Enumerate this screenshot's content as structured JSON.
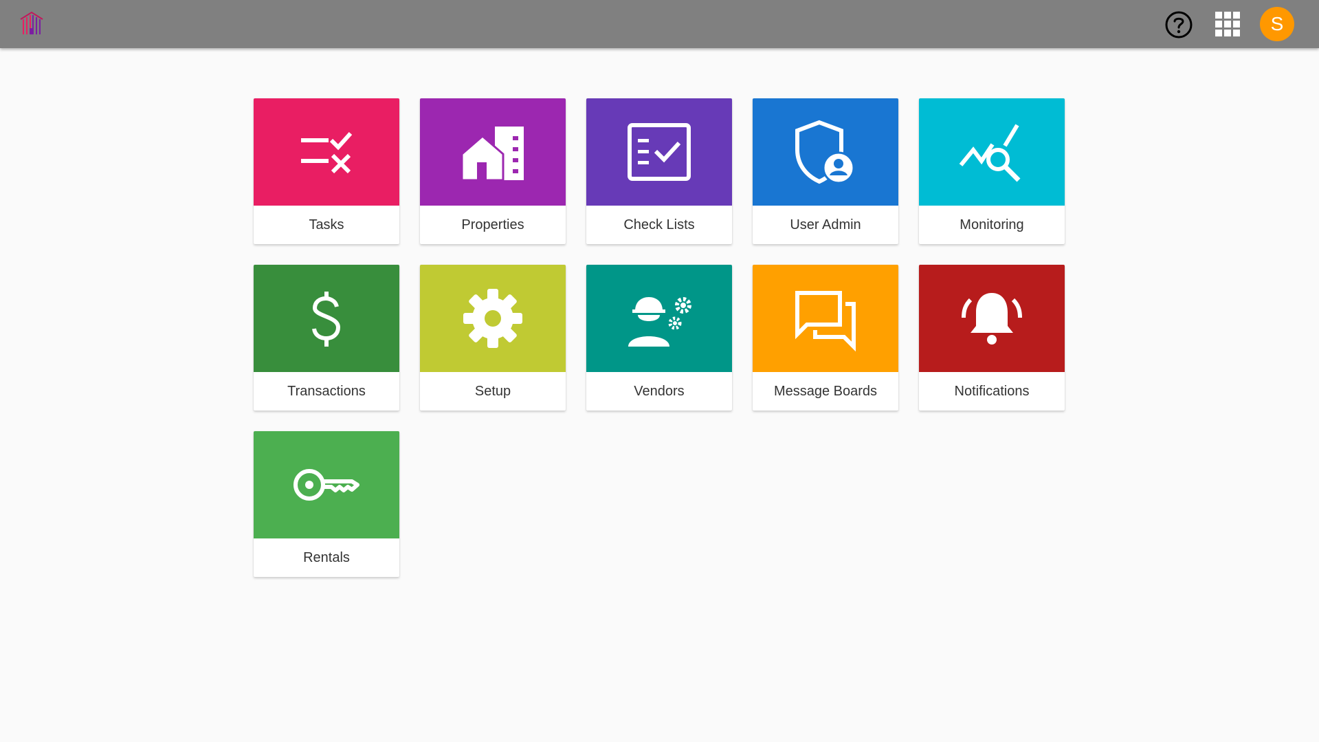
{
  "header": {
    "avatar_letter": "S",
    "colors": {
      "bar": "#808080",
      "avatar": "#ff9800"
    },
    "icons": [
      "building-logo-icon",
      "help-icon",
      "apps-grid-icon",
      "avatar"
    ]
  },
  "tiles": [
    {
      "label": "Tasks",
      "color": "#e91e63",
      "icon": "tasks-icon"
    },
    {
      "label": "Properties",
      "color": "#9c27b0",
      "icon": "properties-icon"
    },
    {
      "label": "Check Lists",
      "color": "#673ab7",
      "icon": "checklist-icon"
    },
    {
      "label": "User Admin",
      "color": "#1976d2",
      "icon": "user-admin-icon"
    },
    {
      "label": "Monitoring",
      "color": "#00bcd4",
      "icon": "monitoring-icon"
    },
    {
      "label": "Transactions",
      "color": "#388e3c",
      "icon": "dollar-icon"
    },
    {
      "label": "Setup",
      "color": "#c0ca33",
      "icon": "gear-icon"
    },
    {
      "label": "Vendors",
      "color": "#009688",
      "icon": "vendors-icon"
    },
    {
      "label": "Message Boards",
      "color": "#ffa000",
      "icon": "message-boards-icon"
    },
    {
      "label": "Notifications",
      "color": "#b71c1c",
      "icon": "bell-icon"
    },
    {
      "label": "Rentals",
      "color": "#4caf50",
      "icon": "key-icon"
    }
  ]
}
